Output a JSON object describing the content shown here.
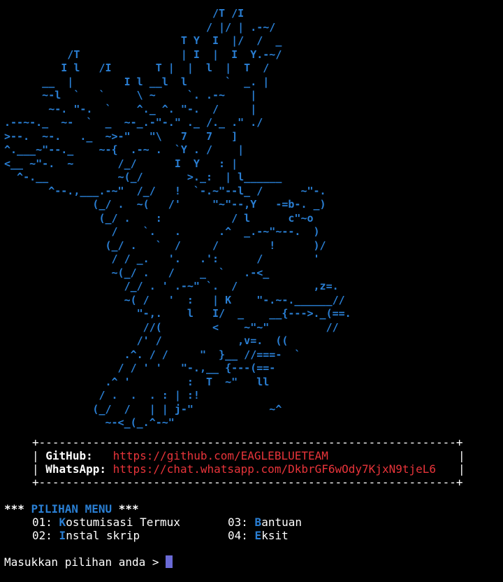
{
  "ascii_art": "                                 /T /I\n                                / |/ | .-~/\n                            T Y  I  |/  /  _\n          /T                | I  |  I  Y.-~/\n         I l   /I       T |  |  l  |  T  /\n      __  |        I l __l  l      `  _. |\n      ~-l  `   `     \\ ~     `. .-~    |\n       ~-. \"-.  `    ^._ ^. \"-.  /     |\n.--~-._  ~-  `  _  ~-_.-\"-.\" ._ /._ .\" ./\n>--.  ~-.   ._  ~>-\"   \"\\   7   7   ]\n^.___~\"--._    ~-{  .-~ .  `Y . /    |\n<__ ~\"-.  ~       /_/      I  Y   : |\n  ^-.__           ~(_/       >._:  | l______\n       ^--.,___.-~\"  /_/   !  `-.~\"--l_ /      ~\"-.\n              (_/ .  ~(   /'     \"~\"--,Y   -=b-. _)\n               (_/ .    :           / l      c\"~o\n                 /    `.   .      .^  _.-~\"~--.  )\n                (_/ .   `  /     /        !      )/\n                 / / _.   '.   .':      /        '\n                 ~(_/ .   /    _  `   .-<_\n                   /_/ . ' .-~\" `.  /            ,z=.\n                   ~( /   '  :   | K    \"-.~-.______//\n                     \"-,.    l   I/  _    __{--->._(==.\n                      //(        <    ~\"~\"         //\n                     /' /            ,v=.  ((\n                   .^. / /     \"  }__ //===-  `\n                  / / ' '   \"-.,__ {---(==-\n                .^ '         :  T  ~\"   ll\n               / .  .  . : | :!\n              (_/  /   | | j-\"            ~^\n                ~-<_(_.^-~\"",
  "info_box": {
    "border_line": "+--------------------------------------------------------------+",
    "github_label": "GitHub:",
    "github_url": "https://github.com/EAGLEBLUETEAM",
    "whatsapp_label": "WhatsApp:",
    "whatsapp_url": "https://chat.whatsapp.com/DkbrGF6wOdy7KjxN9tjeL6",
    "pipe": "|"
  },
  "menu": {
    "stars_left": "***",
    "title": "PILIHAN MENU",
    "stars_right": "***",
    "items": [
      {
        "num": "01:",
        "key": "K",
        "rest": "ostumisasi Termux"
      },
      {
        "num": "02:",
        "key": "I",
        "rest": "nstal skrip"
      },
      {
        "num": "03:",
        "key": "B",
        "rest": "antuan"
      },
      {
        "num": "04:",
        "key": "E",
        "rest": "ksit"
      }
    ]
  },
  "prompt": {
    "text": "Masukkan pilihan anda > "
  },
  "colors": {
    "background": "#000000",
    "art": "#2a7fd4",
    "url": "#e8343a",
    "accent": "#2a7fd4",
    "cursor": "#6a6ad6"
  }
}
